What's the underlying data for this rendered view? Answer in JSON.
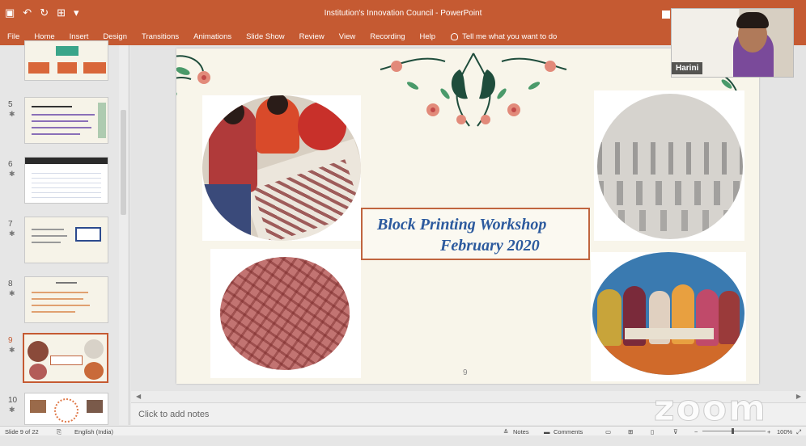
{
  "window": {
    "title": "Institution's Innovation Council - PowerPoint"
  },
  "ribbon": {
    "tabs": [
      "File",
      "Home",
      "Insert",
      "Design",
      "Transitions",
      "Animations",
      "Slide Show",
      "Review",
      "View",
      "Recording",
      "Help"
    ],
    "tell_me": "Tell me what you want to do"
  },
  "thumbnails": [
    {
      "number": "5"
    },
    {
      "number": "6"
    },
    {
      "number": "7"
    },
    {
      "number": "8"
    },
    {
      "number": "9"
    },
    {
      "number": "10"
    }
  ],
  "slide": {
    "title_line1": "Block Printing Workshop",
    "title_line2": "February 2020",
    "page_number": "9"
  },
  "notes": {
    "placeholder": "Click to add notes"
  },
  "status": {
    "slide_counter": "Slide 9 of 22",
    "language": "English (India)",
    "notes_label": "Notes",
    "comments_label": "Comments",
    "zoom": "100%"
  },
  "video": {
    "participant": "Harini"
  },
  "watermark": "zoom",
  "colors": {
    "ribbon": "#c55a32",
    "title_text": "#2c5a9e",
    "title_border": "#c0653f"
  }
}
